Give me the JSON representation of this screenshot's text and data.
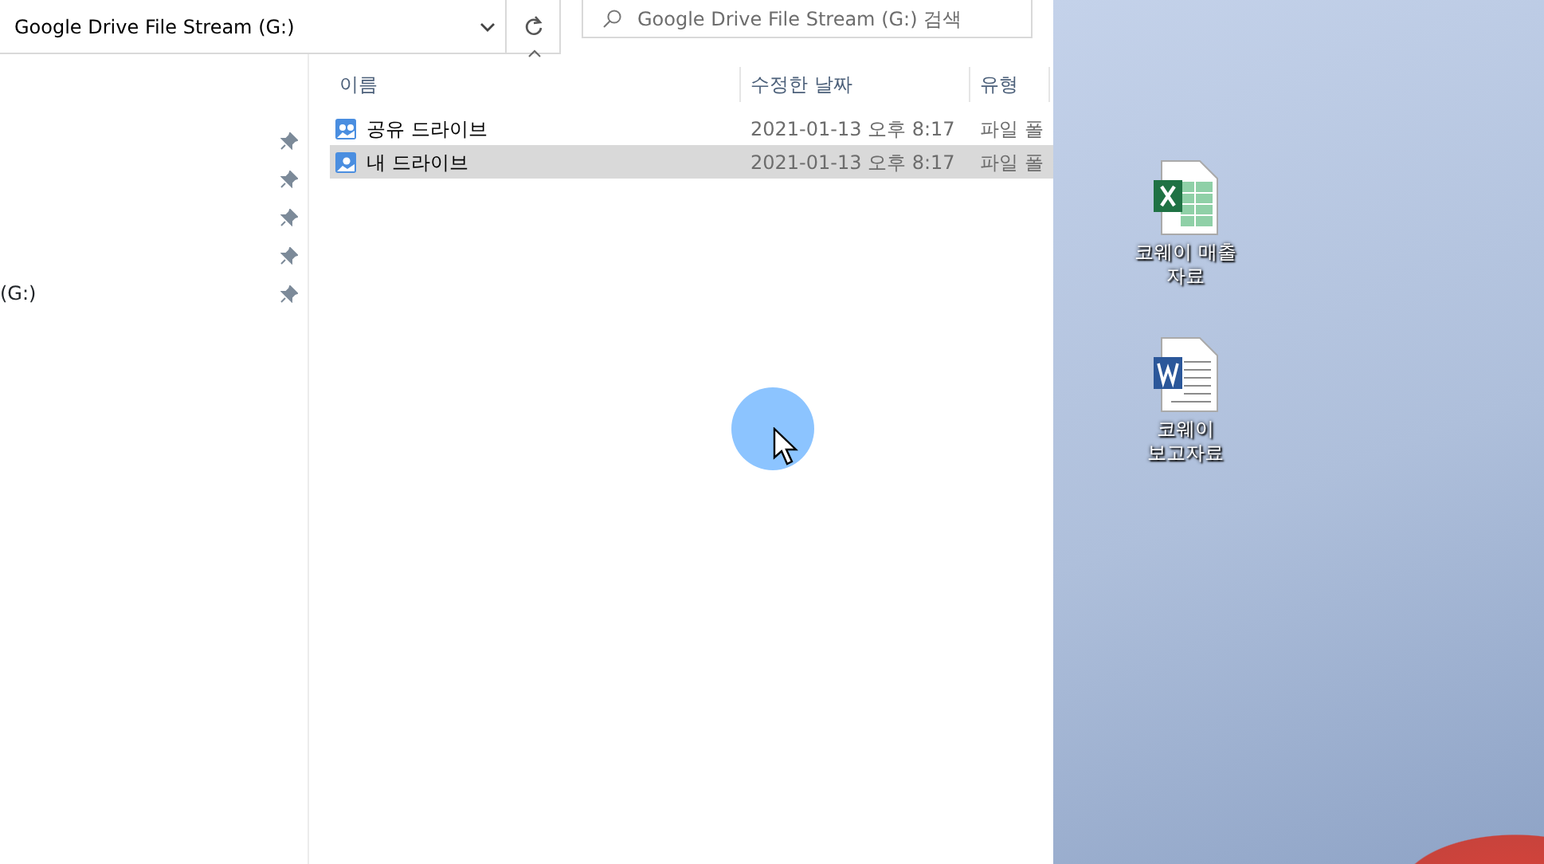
{
  "explorer": {
    "address": "Google Drive File Stream (G:)",
    "search": {
      "placeholder": "Google Drive File Stream (G:) 검색"
    },
    "nav_items": [
      {
        "pinned": true
      },
      {
        "pinned": true
      },
      {
        "pinned": true
      },
      {
        "pinned": true
      },
      {
        "label": "(G:)",
        "pinned": true
      }
    ],
    "columns": [
      "이름",
      "수정한 날짜",
      "유형"
    ],
    "rows": [
      {
        "name": "공유 드라이브",
        "date": "2021-01-13 오후 8:17",
        "type": "파일 폴",
        "kind": "shared",
        "selected": false
      },
      {
        "name": "내 드라이브",
        "date": "2021-01-13 오후 8:17",
        "type": "파일 폴",
        "kind": "mine",
        "selected": true
      }
    ]
  },
  "desktop": {
    "icons": [
      {
        "kind": "excel",
        "label": "코웨이 매출 자료"
      },
      {
        "kind": "word",
        "label": "코웨이 보고자료"
      }
    ]
  }
}
